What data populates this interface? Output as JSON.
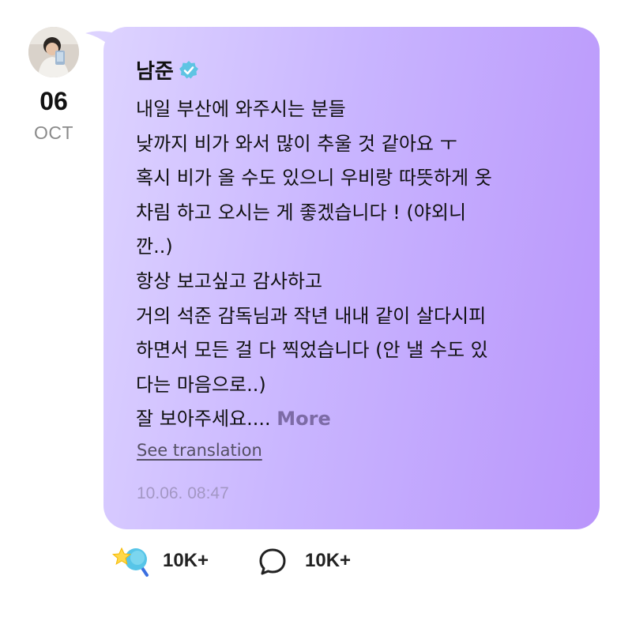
{
  "post": {
    "author": "남준",
    "date_day": "06",
    "date_month": "OCT",
    "lines": [
      "내일 부산에 와주시는 분들",
      "낮까지 비가 와서 많이 추울 것 같아요 ㅜ",
      "혹시 비가 올 수도 있으니 우비랑 따뜻하게 옷",
      "차림 하고 오시는 게 좋겠습니다 ! (야외니",
      "깐..)",
      "항상 보고싶고 감사하고",
      "거의 석준 감독님과 작년 내내 같이 살다시피",
      "하면서 모든 걸 다 찍었습니다 (안 낼 수도 있",
      "다는 마음으로..)"
    ],
    "last_line": "잘 보아주세요....",
    "more_label": "More",
    "see_translation": "See translation",
    "timestamp": "10.06. 08:47"
  },
  "actions": {
    "like_count": "10K+",
    "comment_count": "10K+"
  },
  "icons": {
    "verified": "verified-check-icon",
    "like": "star-lollipop-icon",
    "comment": "speech-bubble-icon",
    "avatar": "user-avatar"
  },
  "colors": {
    "verified": "#5ec4e3",
    "more": "#7d6ba6",
    "timestamp": "#a397c4",
    "bubble_start": "#ddd3ff",
    "bubble_end": "#b995fb"
  }
}
